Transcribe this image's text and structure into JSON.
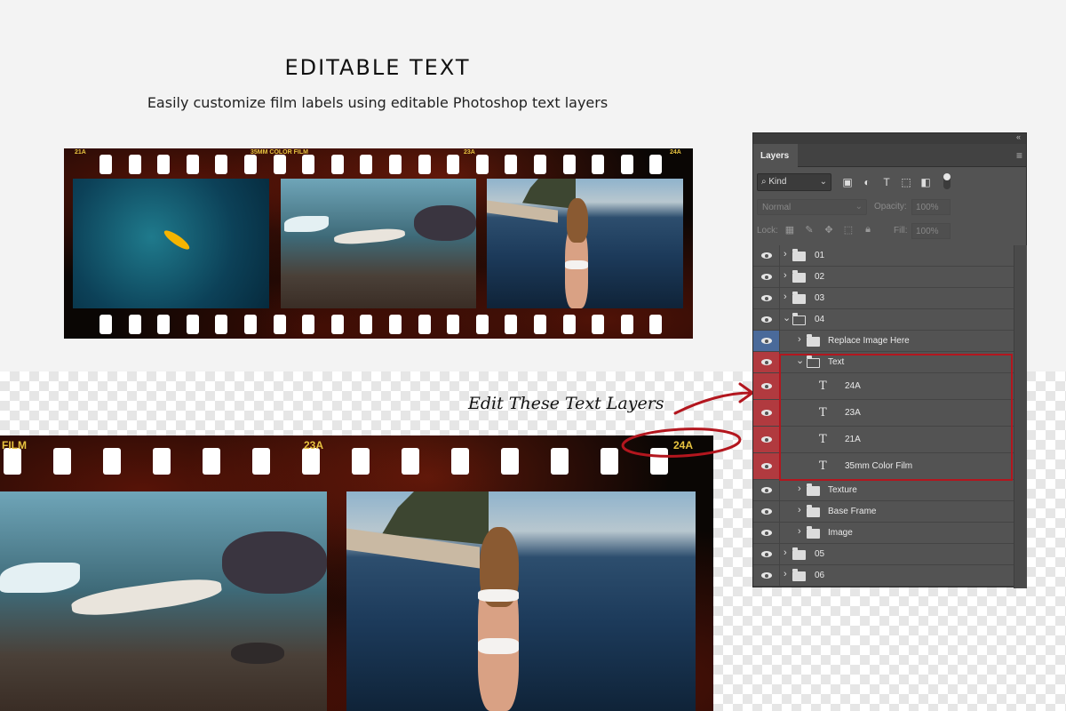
{
  "heading": {
    "title": "EDITABLE TEXT",
    "subtitle": "Easily customize film labels using editable Photoshop text layers"
  },
  "film_top": {
    "labels": [
      "21A",
      "35MM COLOR FILM",
      "23A",
      "24A"
    ]
  },
  "film_bottom": {
    "labels": [
      "FILM",
      "23A",
      "24A"
    ]
  },
  "annotation": "Edit These Text Layers",
  "colors": {
    "highlight": "#b3161e",
    "film_label": "#e8c440",
    "eye_selected": "#4a6a9a",
    "eye_text": "#b13a3f"
  },
  "layers_panel": {
    "tab": "Layers",
    "filter_kind": "Kind",
    "blend_mode": "Normal",
    "opacity_label": "Opacity:",
    "opacity_value": "100%",
    "lock_label": "Lock:",
    "fill_label": "Fill:",
    "fill_value": "100%",
    "layers": [
      {
        "name": "01",
        "type": "folder",
        "level": 0,
        "expanded": false
      },
      {
        "name": "02",
        "type": "folder",
        "level": 0,
        "expanded": false
      },
      {
        "name": "03",
        "type": "folder",
        "level": 0,
        "expanded": false
      },
      {
        "name": "04",
        "type": "folder",
        "level": 0,
        "expanded": true
      },
      {
        "name": "Replace Image Here",
        "type": "folder",
        "level": 1,
        "expanded": false,
        "selected": true
      },
      {
        "name": "Text",
        "type": "folder",
        "level": 1,
        "expanded": true,
        "highlighted": true
      },
      {
        "name": "24A",
        "type": "text",
        "level": 2,
        "highlighted": true
      },
      {
        "name": "23A",
        "type": "text",
        "level": 2,
        "highlighted": true
      },
      {
        "name": "21A",
        "type": "text",
        "level": 2,
        "highlighted": true
      },
      {
        "name": "35mm Color Film",
        "type": "text",
        "level": 2,
        "highlighted": true
      },
      {
        "name": "Texture",
        "type": "folder",
        "level": 1,
        "expanded": false
      },
      {
        "name": "Base Frame",
        "type": "folder",
        "level": 1,
        "expanded": false
      },
      {
        "name": "Image",
        "type": "folder",
        "level": 1,
        "expanded": false
      },
      {
        "name": "05",
        "type": "folder",
        "level": 0,
        "expanded": false
      },
      {
        "name": "06",
        "type": "folder",
        "level": 0,
        "expanded": false
      }
    ]
  }
}
